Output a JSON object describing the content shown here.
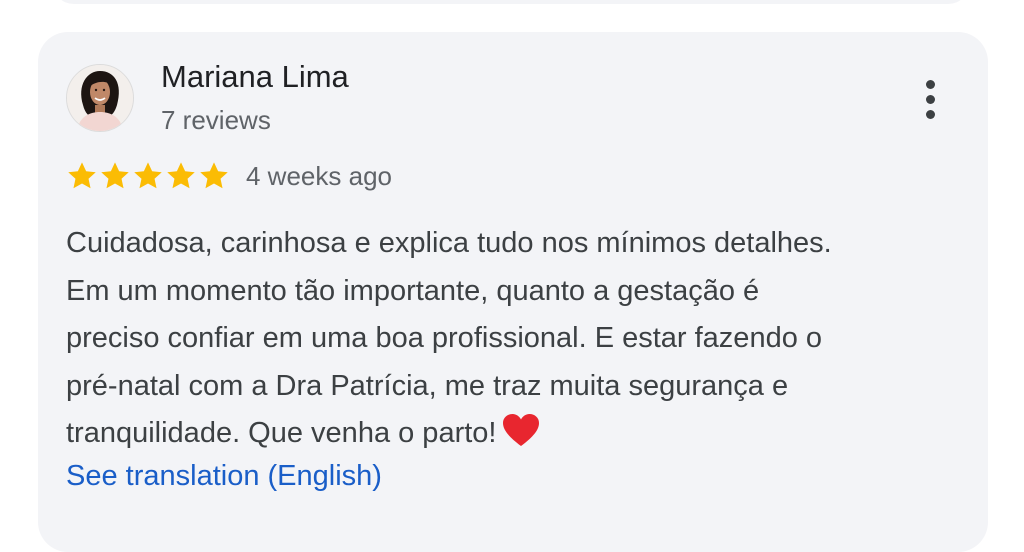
{
  "review": {
    "author_name": "Mariana Lima",
    "review_count": "7 reviews",
    "rating": 5,
    "rating_max": 5,
    "date": "4 weeks ago",
    "text_lines": [
      "Cuidadosa, carinhosa e explica tudo nos mínimos detalhes.",
      "Em um momento tão importante, quanto a gestação é",
      "preciso confiar em uma boa profissional. E estar fazendo o",
      "pré-natal com a Dra Patrícia, me traz muita segurança e",
      "tranquilidade. Que venha o parto!"
    ],
    "emoji": "heart-emoji",
    "see_translation": "See translation (English)",
    "more_icon": "more-vertical-icon"
  },
  "colors": {
    "card_bg": "#f3f4f7",
    "star": "#fbbc04",
    "link": "#1a5ec8",
    "heart": "#e8262f",
    "name": "#202124",
    "secondary": "#5f6368",
    "body": "#3c4043"
  }
}
